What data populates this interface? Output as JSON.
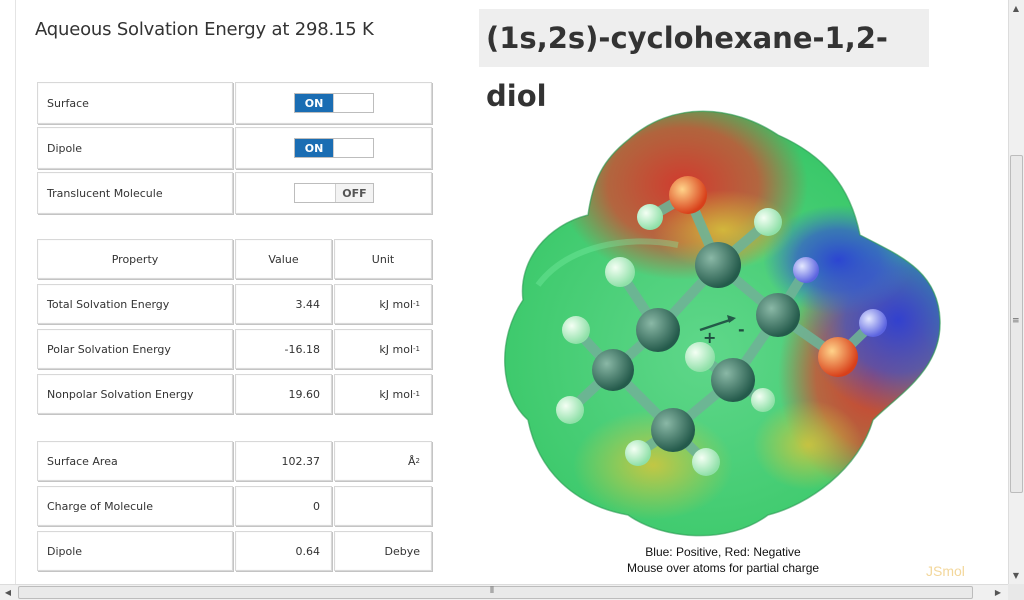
{
  "header": {
    "title": "Aqueous Solvation Energy at 298.15 K",
    "molecule_name": "(1s,2s)-cyclohexane-1,2-diol"
  },
  "toggles": [
    {
      "label": "Surface",
      "state": "ON"
    },
    {
      "label": "Dipole",
      "state": "ON"
    },
    {
      "label": "Translucent Molecule",
      "state": "OFF"
    }
  ],
  "energy_table": {
    "headers": [
      "Property",
      "Value",
      "Unit"
    ],
    "rows": [
      {
        "property": "Total Solvation Energy",
        "value": "3.44",
        "unit_base": "kJ mol",
        "unit_sup": "-1"
      },
      {
        "property": "Polar Solvation Energy",
        "value": "-16.18",
        "unit_base": "kJ mol",
        "unit_sup": "-1"
      },
      {
        "property": "Nonpolar Solvation Energy",
        "value": "19.60",
        "unit_base": "kJ mol",
        "unit_sup": "-1"
      }
    ]
  },
  "props_table": {
    "rows": [
      {
        "property": "Surface Area",
        "value": "102.37",
        "unit_base": "Å",
        "unit_sup": "2"
      },
      {
        "property": "Charge of Molecule",
        "value": "0",
        "unit_base": "",
        "unit_sup": ""
      },
      {
        "property": "Dipole",
        "value": "0.64",
        "unit_base": "Debye",
        "unit_sup": ""
      }
    ]
  },
  "viewer": {
    "legend_line1": "Blue: Positive, Red: Negative",
    "legend_line2": "Mouse over atoms for partial charge",
    "watermark": "JSmol",
    "dipole_plus": "+",
    "dipole_minus": "-"
  },
  "colors": {
    "toggle_on": "#1a6db3",
    "surface_red": "#d23a2c",
    "surface_green": "#3fcf6a",
    "surface_blue": "#2f4fd8"
  }
}
